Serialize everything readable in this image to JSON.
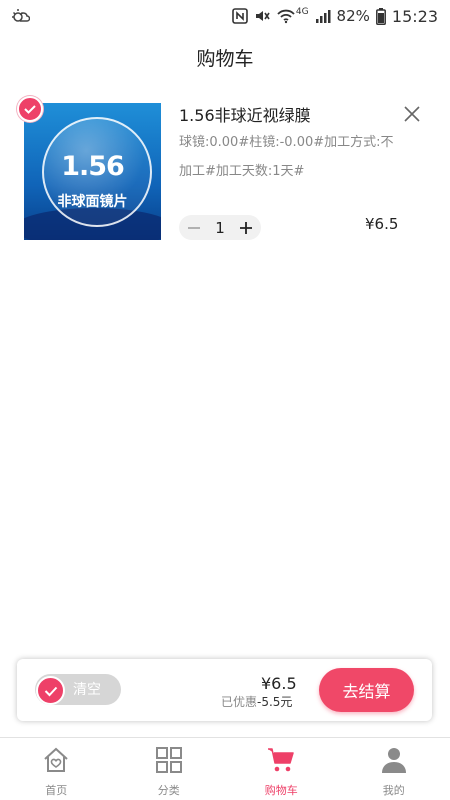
{
  "status_bar": {
    "battery": "82%",
    "time": "15:23",
    "network": "4G"
  },
  "header": {
    "title": "购物车"
  },
  "cart": {
    "items": [
      {
        "checked": true,
        "image_text_main": "1.56",
        "image_text_sub": "非球面镜片",
        "title": "1.56非球近视绿膜",
        "spec": "球镜:0.00#柱镜:-0.00#加工方式:不加工#加工天数:1天#",
        "quantity": "1",
        "price": "¥6.5"
      }
    ]
  },
  "checkout": {
    "clear_label": "清空",
    "total": "¥6.5",
    "discount_prefix": "已优惠",
    "discount_value": "-5.5元",
    "button_label": "去结算"
  },
  "tabs": [
    {
      "label": "首页",
      "icon": "home-icon",
      "active": false
    },
    {
      "label": "分类",
      "icon": "grid-icon",
      "active": false
    },
    {
      "label": "购物车",
      "icon": "cart-icon",
      "active": true
    },
    {
      "label": "我的",
      "icon": "user-icon",
      "active": false
    }
  ],
  "colors": {
    "accent": "#ee4068",
    "inactive": "#8a8a8a"
  }
}
